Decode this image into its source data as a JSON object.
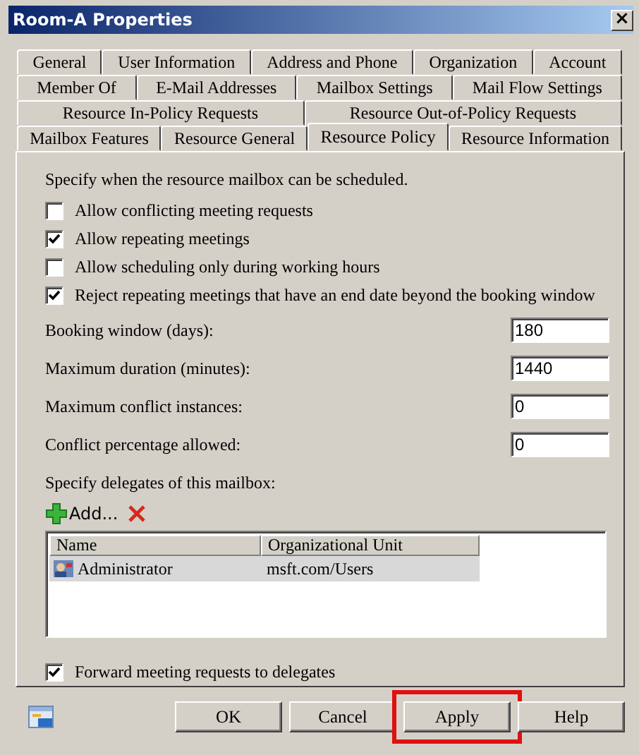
{
  "window": {
    "title": "Room-A Properties",
    "close": "×"
  },
  "tab_rows": [
    {
      "tabs": [
        {
          "label": "General",
          "selected": false
        },
        {
          "label": "User Information",
          "selected": false
        },
        {
          "label": "Address and Phone",
          "selected": false
        },
        {
          "label": "Organization",
          "selected": false
        },
        {
          "label": "Account",
          "selected": false
        }
      ]
    },
    {
      "tabs": [
        {
          "label": "Member Of",
          "selected": false
        },
        {
          "label": "E-Mail Addresses",
          "selected": false
        },
        {
          "label": "Mailbox Settings",
          "selected": false
        },
        {
          "label": "Mail Flow Settings",
          "selected": false
        }
      ]
    },
    {
      "tabs": [
        {
          "label": "Resource In-Policy Requests",
          "selected": false
        },
        {
          "label": "Resource Out-of-Policy Requests",
          "selected": false
        }
      ]
    },
    {
      "tabs": [
        {
          "label": "Mailbox Features",
          "selected": false
        },
        {
          "label": "Resource General",
          "selected": false
        },
        {
          "label": "Resource Policy",
          "selected": true
        },
        {
          "label": "Resource Information",
          "selected": false
        }
      ]
    }
  ],
  "schedule_heading": "Specify when the resource mailbox can be scheduled.",
  "options": [
    {
      "label": "Allow conflicting meeting requests",
      "checked": false
    },
    {
      "label": "Allow repeating meetings",
      "checked": true
    },
    {
      "label": "Allow scheduling only during working hours",
      "checked": false
    },
    {
      "label": "Reject repeating meetings that have an end date beyond the booking window",
      "checked": true
    }
  ],
  "fields": [
    {
      "label": "Booking window (days):",
      "value": "180"
    },
    {
      "label": "Maximum duration (minutes):",
      "value": "1440"
    },
    {
      "label": "Maximum conflict instances:",
      "value": "0"
    },
    {
      "label": "Conflict percentage allowed:",
      "value": "0"
    }
  ],
  "delegates_heading": "Specify delegates of this mailbox:",
  "add_button": "Add...",
  "delegates": {
    "columns": [
      "Name",
      "Organizational Unit"
    ],
    "rows": [
      {
        "name": "Administrator",
        "unit": "msft.com/Users",
        "selected": true
      }
    ]
  },
  "forward": {
    "label": "Forward meeting requests to delegates",
    "checked": true
  },
  "buttons": [
    {
      "label": "OK",
      "highlighted": false
    },
    {
      "label": "Cancel",
      "highlighted": false
    },
    {
      "label": "Apply",
      "highlighted": true
    },
    {
      "label": "Help",
      "highlighted": false
    }
  ]
}
